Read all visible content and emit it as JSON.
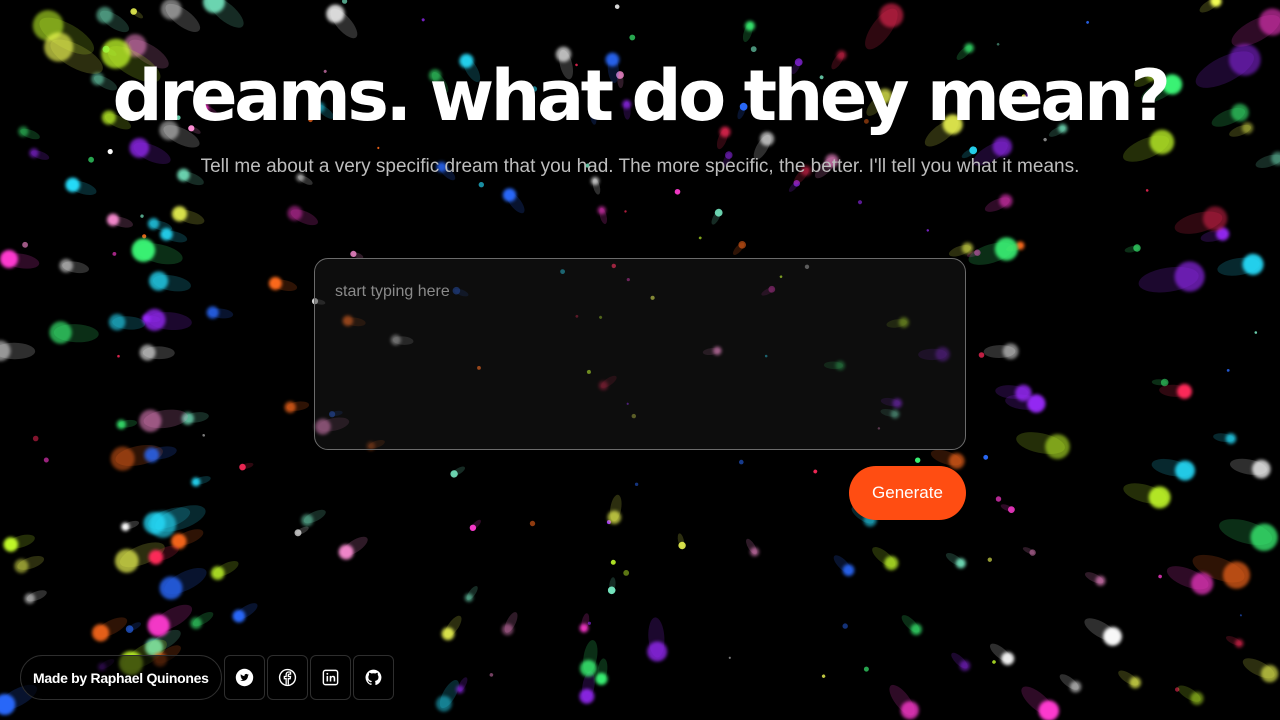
{
  "page": {
    "title": "dreams. what do they mean?",
    "subtitle": "Tell me about a very specific dream that you had. The more specific, the better. I'll tell you what it means."
  },
  "dream_input": {
    "placeholder": "start typing here",
    "value": ""
  },
  "actions": {
    "generate_label": "Generate"
  },
  "footer": {
    "credit": "Made by Raphael Quinones",
    "social_links": [
      {
        "name": "twitter",
        "icon": "twitter-icon"
      },
      {
        "name": "facebook",
        "icon": "facebook-icon"
      },
      {
        "name": "linkedin",
        "icon": "linkedin-icon"
      },
      {
        "name": "github",
        "icon": "github-icon"
      }
    ]
  },
  "colors": {
    "background": "#000000",
    "accent": "#ff4d12",
    "title": "#ffffff",
    "subtitle": "#bdbdbd",
    "input_border": "#6b6b6b"
  }
}
